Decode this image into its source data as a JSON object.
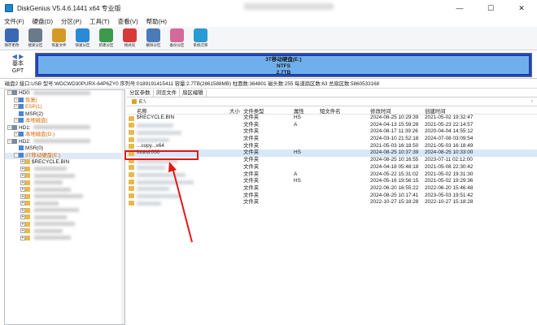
{
  "window": {
    "title": "DiskGenius V5.4.6.1441 x64 专业版",
    "minimize": "—",
    "maximize": "☐",
    "close": "✕"
  },
  "menu": [
    "文件(F)",
    "硬盘(D)",
    "分区(P)",
    "工具(T)",
    "查看(V)",
    "帮助(H)"
  ],
  "toolbar": [
    {
      "label": "保存更改",
      "icon": "save-icon",
      "color": "#3a68b4"
    },
    {
      "label": "搜索分区",
      "icon": "search-partition-icon",
      "color": "#6b7a8a"
    },
    {
      "label": "恢复文件",
      "icon": "recover-files-icon",
      "color": "#d49a28"
    },
    {
      "label": "快速分区",
      "icon": "quick-partition-icon",
      "color": "#2a8ad4"
    },
    {
      "label": "新建分区",
      "icon": "new-partition-icon",
      "color": "#3c9a4c"
    },
    {
      "label": "格式化",
      "icon": "format-icon",
      "color": "#d83a3a"
    },
    {
      "label": "删除分区",
      "icon": "delete-partition-icon",
      "color": "#4a7ab8"
    },
    {
      "label": "备份分区",
      "icon": "backup-partition-icon",
      "color": "#d26a9a"
    },
    {
      "label": "系统迁移",
      "icon": "system-migrate-icon",
      "color": "#2a9ad4"
    }
  ],
  "diskbar": {
    "nav_label_1": "基本",
    "nav_label_2": "GPT",
    "partition_name": "3T移动硬盘(E:)",
    "partition_fs": "NTFS",
    "partition_size": "2.7TB"
  },
  "disk_info": "磁盘2 接口:USB  型号:WDCWD30PURX-64P6ZY0  序列号:0189191415411  容量:2.7TB(2861588MB)  柱面数:364801  磁头数:255  每道扇区数:63  总扇区数:5860533168",
  "tree": [
    {
      "indent": 0,
      "toggle": "−",
      "label": "HD0:",
      "cls": "",
      "blur": 70
    },
    {
      "indent": 1,
      "toggle": "+",
      "label": "恢复(",
      "cls": "orange",
      "blur": 0
    },
    {
      "indent": 1,
      "toggle": "+",
      "label": "ESP(1)",
      "cls": "orange",
      "blur": 0
    },
    {
      "indent": 1,
      "toggle": "",
      "label": "MSR(2)",
      "cls": "",
      "blur": 0
    },
    {
      "indent": 1,
      "toggle": "+",
      "label": "本地磁盘(",
      "cls": "orange",
      "blur": 0
    },
    {
      "indent": 0,
      "toggle": "−",
      "label": "HD1:",
      "cls": "",
      "blur": 70
    },
    {
      "indent": 1,
      "toggle": "+",
      "label": "本地磁盘(D:)",
      "cls": "orange",
      "blur": 0
    },
    {
      "indent": 0,
      "toggle": "−",
      "label": "HD2:",
      "cls": "",
      "blur": 70
    },
    {
      "indent": 1,
      "toggle": "",
      "label": "MSR(0)",
      "cls": "",
      "blur": 0
    },
    {
      "indent": 1,
      "toggle": "−",
      "label": "3T移动硬盘(E:)",
      "cls": "orange sel",
      "blur": 0
    },
    {
      "indent": 2,
      "toggle": "+",
      "label": "$RECYCLE.BIN",
      "cls": "",
      "blur": 0
    },
    {
      "indent": 2,
      "toggle": "+",
      "label": "",
      "cls": "",
      "blur": 40
    },
    {
      "indent": 2,
      "toggle": "+",
      "label": "",
      "cls": "",
      "blur": 50
    },
    {
      "indent": 2,
      "toggle": "+",
      "label": "",
      "cls": "",
      "blur": 35
    },
    {
      "indent": 2,
      "toggle": "+",
      "label": "",
      "cls": "",
      "blur": 45
    },
    {
      "indent": 2,
      "toggle": "+",
      "label": "",
      "cls": "",
      "blur": 60
    },
    {
      "indent": 2,
      "toggle": "+",
      "label": "",
      "cls": "",
      "blur": 30
    },
    {
      "indent": 2,
      "toggle": "+",
      "label": "",
      "cls": "",
      "blur": 55
    },
    {
      "indent": 2,
      "toggle": "+",
      "label": "",
      "cls": "",
      "blur": 40
    },
    {
      "indent": 2,
      "toggle": "+",
      "label": "",
      "cls": "",
      "blur": 50
    },
    {
      "indent": 2,
      "toggle": "+",
      "label": "",
      "cls": "",
      "blur": 35
    },
    {
      "indent": 2,
      "toggle": "+",
      "label": "",
      "cls": "",
      "blur": 45
    }
  ],
  "tabs": [
    "分区参数",
    "浏览文件",
    "扇区编辑"
  ],
  "path": "E:\\",
  "path_up": "↑",
  "columns": [
    "名称",
    "大小",
    "文件类型",
    "属性",
    "短文件名",
    "修改时间",
    "创建时间"
  ],
  "files": [
    {
      "name": "$RECYCLE.BIN",
      "size": "",
      "type": "文件夹",
      "attr": "HS",
      "short": "",
      "modified": "2024-08-25 10:29:39",
      "created": "2021-05-02 19:32:47",
      "blur": 0,
      "hl": false
    },
    {
      "name": "",
      "size": "",
      "type": "文件夹",
      "attr": "A",
      "short": "",
      "modified": "2024-04-13 15:59:28",
      "created": "2021-05-23 22:14:57",
      "blur": 45,
      "hl": false
    },
    {
      "name": "",
      "size": "",
      "type": "文件夹",
      "attr": "",
      "short": "",
      "modified": "2024-08-17 11:39:26",
      "created": "2020-04-04 14:55:12",
      "blur": 55,
      "hl": false
    },
    {
      "name": "",
      "size": "",
      "type": "文件夹",
      "attr": "",
      "short": "",
      "modified": "2024-03-10 21:52:18",
      "created": "2024-07-08 03:09:54",
      "blur": 40,
      "hl": false
    },
    {
      "name": "...copy...x64",
      "size": "",
      "type": "文件夹",
      "attr": "",
      "short": "",
      "modified": "2021-05-03 16:18:50",
      "created": "2021-05-03 16:18:49",
      "blur": 0,
      "hl": false
    },
    {
      "name": "found.000",
      "size": "",
      "type": "文件夹",
      "attr": "HS",
      "short": "",
      "modified": "2024-08-25 10:37:39",
      "created": "2024-08-25 10:33:00",
      "blur": 0,
      "hl": true
    },
    {
      "name": "",
      "size": "",
      "type": "文件夹",
      "attr": "",
      "short": "",
      "modified": "2024-08-25 10:16:55",
      "created": "2023-07-11 02:12:00",
      "blur": 50,
      "hl": false
    },
    {
      "name": "",
      "size": "",
      "type": "文件夹",
      "attr": "",
      "short": "",
      "modified": "2024-04-18 05:48:18",
      "created": "2021-05-08 22:30:42",
      "blur": 35,
      "hl": false
    },
    {
      "name": "",
      "size": "",
      "type": "文件夹",
      "attr": "A",
      "short": "",
      "modified": "2024-05-22 15:31:02",
      "created": "2021-05-02 19:31:30",
      "blur": 60,
      "hl": false
    },
    {
      "name": "",
      "size": "",
      "type": "文件夹",
      "attr": "HS",
      "short": "",
      "modified": "2024-05-16 19:56:15",
      "created": "2021-05-02 19:29:36",
      "blur": 70,
      "hl": false
    },
    {
      "name": "",
      "size": "",
      "type": "文件夹",
      "attr": "",
      "short": "",
      "modified": "2022-06-20 16:55:22",
      "created": "2022-06-20 15:46:48",
      "blur": 40,
      "hl": false
    },
    {
      "name": "",
      "size": "",
      "type": "文件夹",
      "attr": "",
      "short": "",
      "modified": "2024-08-25 10:17:41",
      "created": "2023-05-03 19:51:42",
      "blur": 55,
      "hl": false
    },
    {
      "name": "",
      "size": "",
      "type": "文件夹",
      "attr": "",
      "short": "",
      "modified": "2022-10-27 15:18:28",
      "created": "2022-10-27 15:18:28",
      "blur": 30,
      "hl": false
    }
  ],
  "colors": {
    "accent": "#2046c8",
    "highlight_box": "#e21818",
    "folder": "#e8b94a"
  }
}
